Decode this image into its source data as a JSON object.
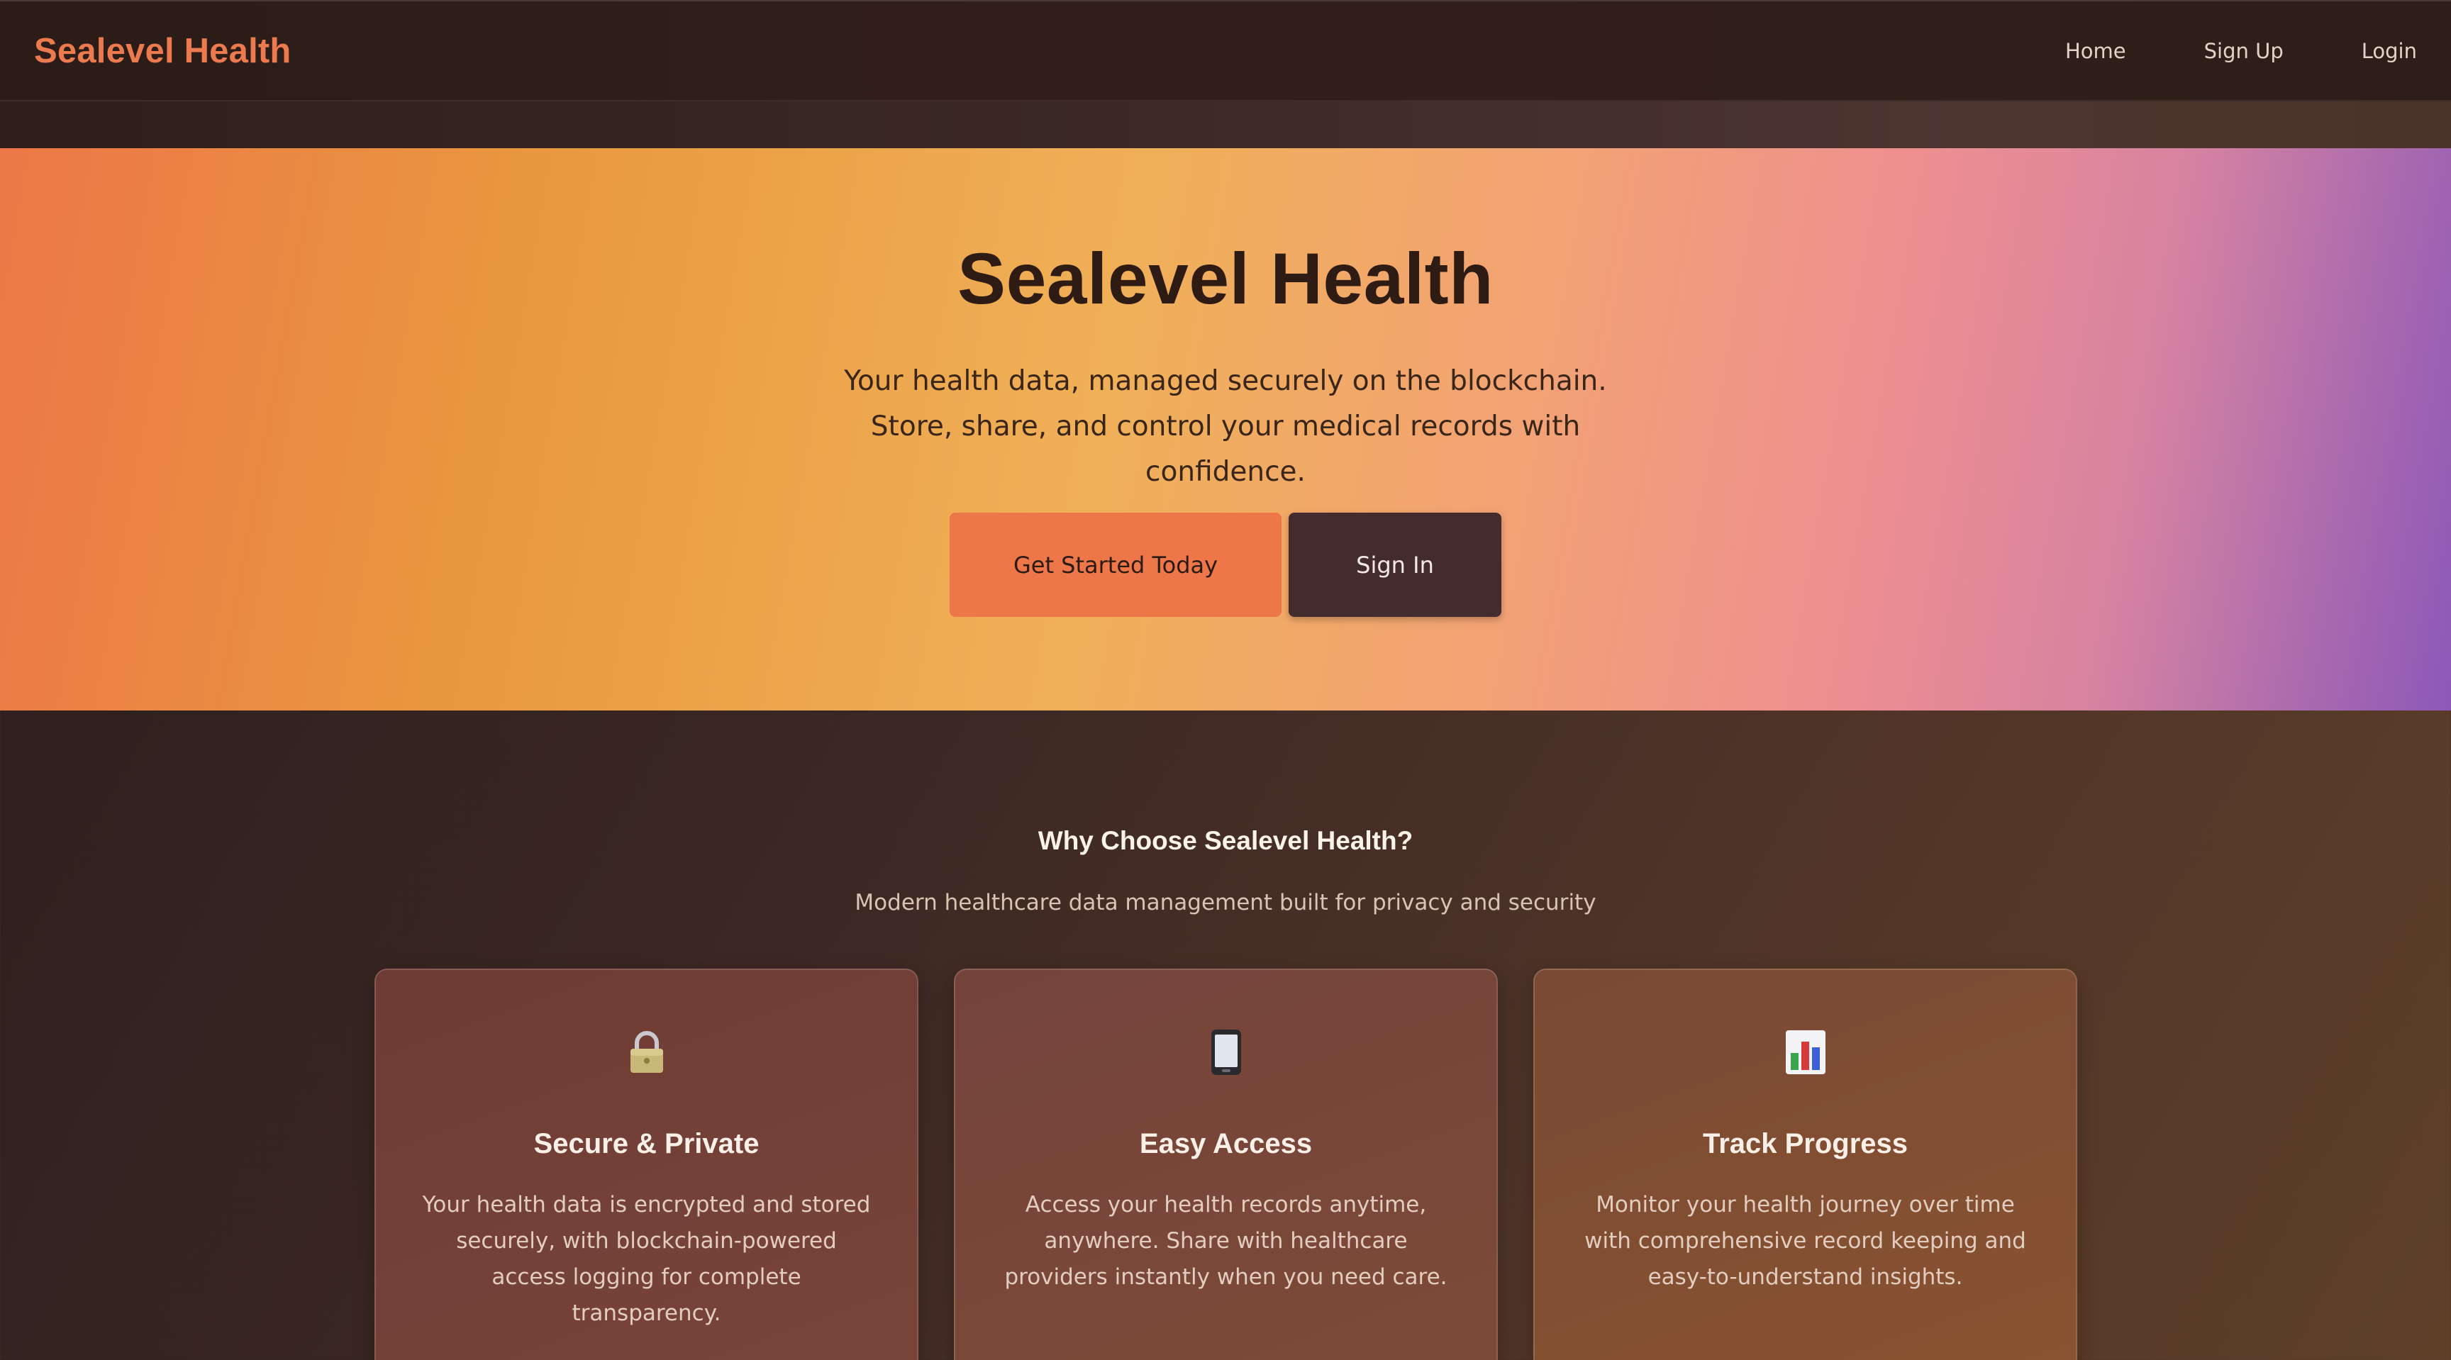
{
  "nav": {
    "brand": "Sealevel Health",
    "links": [
      "Home",
      "Sign Up",
      "Login"
    ]
  },
  "hero": {
    "title": "Sealevel Health",
    "subtitle": "Your health data, managed securely on the blockchain. Store, share, and control your medical records with confidence.",
    "primary_button": "Get Started Today",
    "secondary_button": "Sign In"
  },
  "features": {
    "title": "Why Choose Sealevel Health?",
    "subtitle": "Modern healthcare data management built for privacy and security",
    "cards": [
      {
        "icon": "lock-icon",
        "title": "Secure & Private",
        "text": "Your health data is encrypted and stored securely, with blockchain-powered access logging for complete transparency."
      },
      {
        "icon": "mobile-phone-icon",
        "title": "Easy Access",
        "text": "Access your health records anytime, anywhere. Share with healthcare providers instantly when you need care."
      },
      {
        "icon": "bar-chart-icon",
        "title": "Track Progress",
        "text": "Monitor your health journey over time with comprehensive record keeping and easy-to-understand insights."
      }
    ]
  },
  "colors": {
    "brand_accent": "#ec7a4f",
    "primary_button": "#ed7748",
    "secondary_button": "#432b2e"
  }
}
